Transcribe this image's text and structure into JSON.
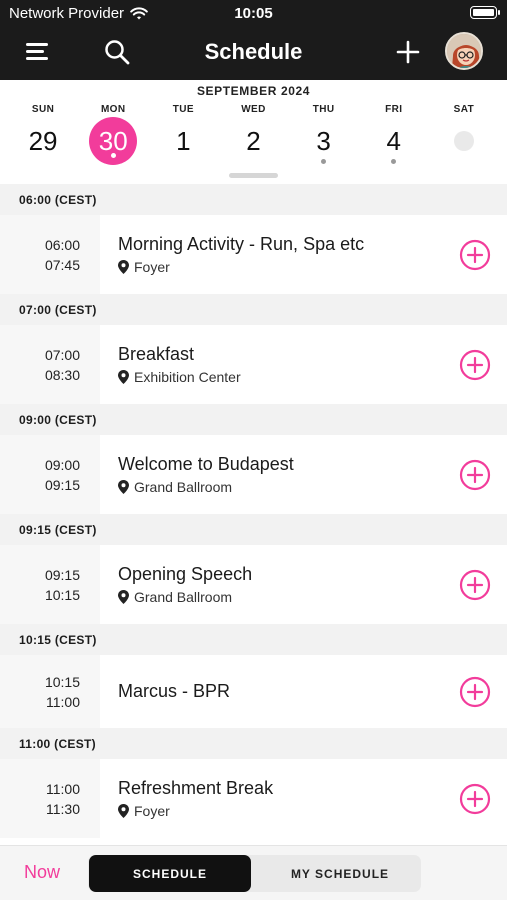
{
  "status_bar": {
    "carrier": "Network Provider",
    "time": "10:05"
  },
  "header": {
    "title": "Schedule",
    "icons": [
      "menu-icon",
      "search-icon",
      "plus-icon",
      "avatar"
    ]
  },
  "calendar": {
    "month_label": "SEPTEMBER 2024",
    "days": [
      {
        "dow": "SUN",
        "num": "29"
      },
      {
        "dow": "MON",
        "num": "30"
      },
      {
        "dow": "TUE",
        "num": "1"
      },
      {
        "dow": "WED",
        "num": "2"
      },
      {
        "dow": "THU",
        "num": "3"
      },
      {
        "dow": "FRI",
        "num": "4"
      },
      {
        "dow": "SAT",
        "num": ""
      }
    ]
  },
  "schedule": {
    "groups": [
      {
        "header": "06:00 (CEST)",
        "start": "06:00",
        "end": "07:45",
        "title": "Morning Activity - Run, Spa etc",
        "location": "Foyer"
      },
      {
        "header": "07:00 (CEST)",
        "start": "07:00",
        "end": "08:30",
        "title": "Breakfast",
        "location": "Exhibition Center"
      },
      {
        "header": "09:00 (CEST)",
        "start": "09:00",
        "end": "09:15",
        "title": "Welcome to Budapest",
        "location": "Grand Ballroom"
      },
      {
        "header": "09:15 (CEST)",
        "start": "09:15",
        "end": "10:15",
        "title": "Opening Speech",
        "location": "Grand Ballroom"
      },
      {
        "header": "10:15 (CEST)",
        "start": "10:15",
        "end": "11:00",
        "title": "Marcus - BPR",
        "location": ""
      },
      {
        "header": "11:00 (CEST)",
        "start": "11:00",
        "end": "11:30",
        "title": "Refreshment Break",
        "location": "Foyer"
      }
    ]
  },
  "bottom_bar": {
    "now_label": "Now",
    "tab_schedule": "SCHEDULE",
    "tab_my_schedule": "MY SCHEDULE"
  },
  "colors": {
    "accent": "#f23c9b",
    "header_bg": "#1b1b1b",
    "group_header_bg": "#f2f2f2"
  }
}
